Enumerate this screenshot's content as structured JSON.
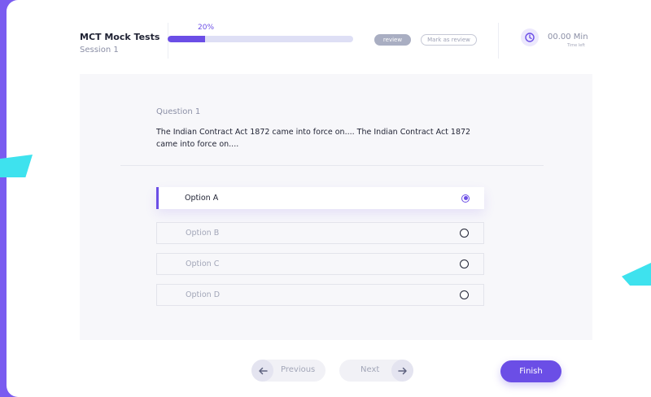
{
  "header": {
    "title": "MCT Mock Tests",
    "session": "Session 1",
    "progress_percent": 20,
    "progress_label": "20%",
    "review_label": "review",
    "mark_review_label": "Mark as review",
    "timer_value": "00.00 Min",
    "timer_caption": "Time left"
  },
  "question": {
    "label": "Question 1",
    "text": "The Indian Contract Act 1872 came into force on.... The Indian Contract Act 1872 came into force on....",
    "options": [
      {
        "label": "Option A",
        "selected": true
      },
      {
        "label": "Option B",
        "selected": false
      },
      {
        "label": "Option C",
        "selected": false
      },
      {
        "label": "Option D",
        "selected": false
      }
    ]
  },
  "footer": {
    "previous_label": "Previous",
    "next_label": "Next",
    "finish_label": "Finish"
  },
  "colors": {
    "accent": "#6b4ee6",
    "decor": "#3ee2ee"
  }
}
